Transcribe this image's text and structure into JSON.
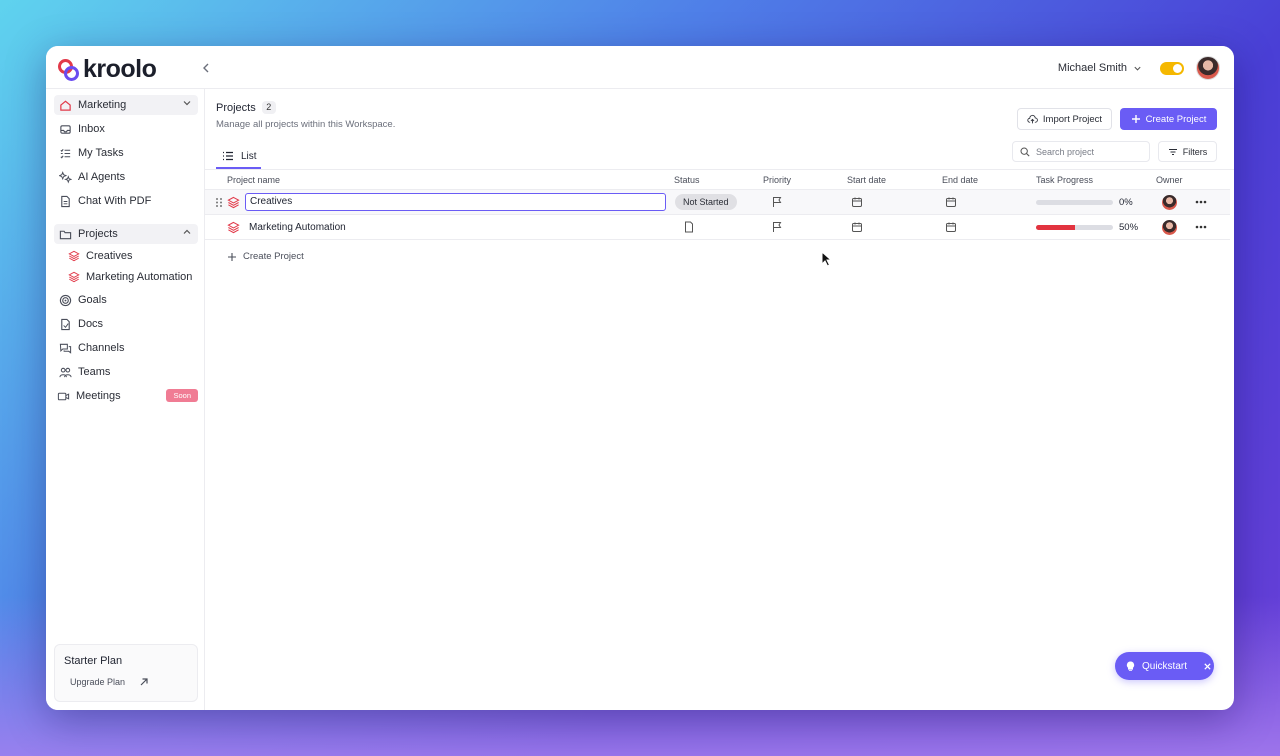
{
  "brand": {
    "name": "kroolo",
    "colors": {
      "red": "#e23a4a",
      "purple": "#6a4cf0",
      "accent": "#6a5cf5"
    }
  },
  "topbar": {
    "user_name": "Michael Smith"
  },
  "sidebar": {
    "workspace": "Marketing",
    "items": [
      {
        "label": "Inbox",
        "icon": "inbox-icon"
      },
      {
        "label": "My Tasks",
        "icon": "tasks-icon"
      },
      {
        "label": "AI Agents",
        "icon": "sparkle-icon"
      },
      {
        "label": "Chat With PDF",
        "icon": "pdf-icon"
      }
    ],
    "projects_label": "Projects",
    "projects": [
      {
        "label": "Creatives"
      },
      {
        "label": "Marketing Automation"
      }
    ],
    "items2": [
      {
        "label": "Goals",
        "icon": "target-icon"
      },
      {
        "label": "Docs",
        "icon": "doc-icon"
      },
      {
        "label": "Channels",
        "icon": "chat-icon"
      },
      {
        "label": "Teams",
        "icon": "team-icon"
      },
      {
        "label": "Meetings",
        "icon": "video-icon",
        "badge": "Soon"
      }
    ],
    "plan": {
      "title": "Starter Plan",
      "upgrade": "Upgrade Plan"
    }
  },
  "main": {
    "title": "Projects",
    "count": "2",
    "subtitle": "Manage all projects within this Workspace.",
    "import_label": "Import Project",
    "create_label": "Create Project",
    "tab_list": "List",
    "search_placeholder": "Search project",
    "filters_label": "Filters",
    "columns": {
      "name": "Project name",
      "status": "Status",
      "priority": "Priority",
      "start": "Start date",
      "end": "End date",
      "progress": "Task Progress",
      "owner": "Owner"
    },
    "rows": [
      {
        "name": "Creatives",
        "status": "Not Started",
        "progress": 0,
        "progress_label": "0%"
      },
      {
        "name": "Marketing Automation",
        "status": "",
        "progress": 50,
        "progress_label": "50%"
      }
    ],
    "create_row_label": "Create Project",
    "quickstart_label": "Quickstart"
  }
}
